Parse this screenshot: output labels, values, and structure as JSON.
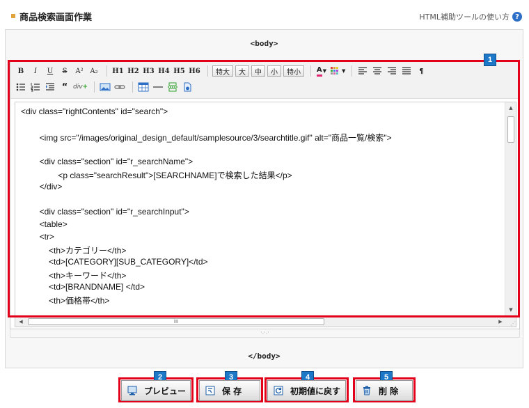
{
  "header": {
    "title": "商品検索画面作業",
    "help_label": "HTML補助ツールの使い方",
    "help_icon": "?"
  },
  "editor": {
    "body_open": "<body>",
    "body_close": "</body>",
    "toolbar": {
      "row1": [
        "B",
        "I",
        "U",
        "S",
        "A²",
        "A₂",
        "H1",
        "H2",
        "H3",
        "H4",
        "H5",
        "H6"
      ],
      "sizes": [
        "特大",
        "大",
        "中",
        "小",
        "特小"
      ],
      "color_label": "A",
      "paragraph_mark": "¶",
      "quote_mark": "“",
      "div_label": "div"
    },
    "code_lines": [
      "<div class=\"rightContents\" id=\"search\">",
      "",
      "        <img src=\"/images/original_design_default/samplesource/3/searchtitle.gif\" alt=\"商品一覧/検索\">",
      "",
      "        <div class=\"section\" id=\"r_searchName\">",
      "                <p class=\"searchResult\">[SEARCHNAME]で検索した結果</p>",
      "        </div>",
      "",
      "        <div class=\"section\" id=\"r_searchInput\">",
      "        <table>",
      "        <tr>",
      "            <th>カテゴリー</th>",
      "            <td>[CATEGORY][SUB_CATEGORY]</td>",
      "            <th>キーワード</th>",
      "            <td>[BRANDNAME] </td>",
      "            <th>価格帯</th>"
    ],
    "hscroll_mark": "III",
    "grip_mark": "·.·.·"
  },
  "badges": [
    "1",
    "2",
    "3",
    "4",
    "5"
  ],
  "actions": {
    "preview": "プレビュー",
    "save": "保 存",
    "reset": "初期値に戻す",
    "delete": "削 除"
  },
  "colors": {
    "highlight_red": "#e2001a",
    "badge_blue": "#1d79c8",
    "header_bullet": "#e0a53a"
  }
}
